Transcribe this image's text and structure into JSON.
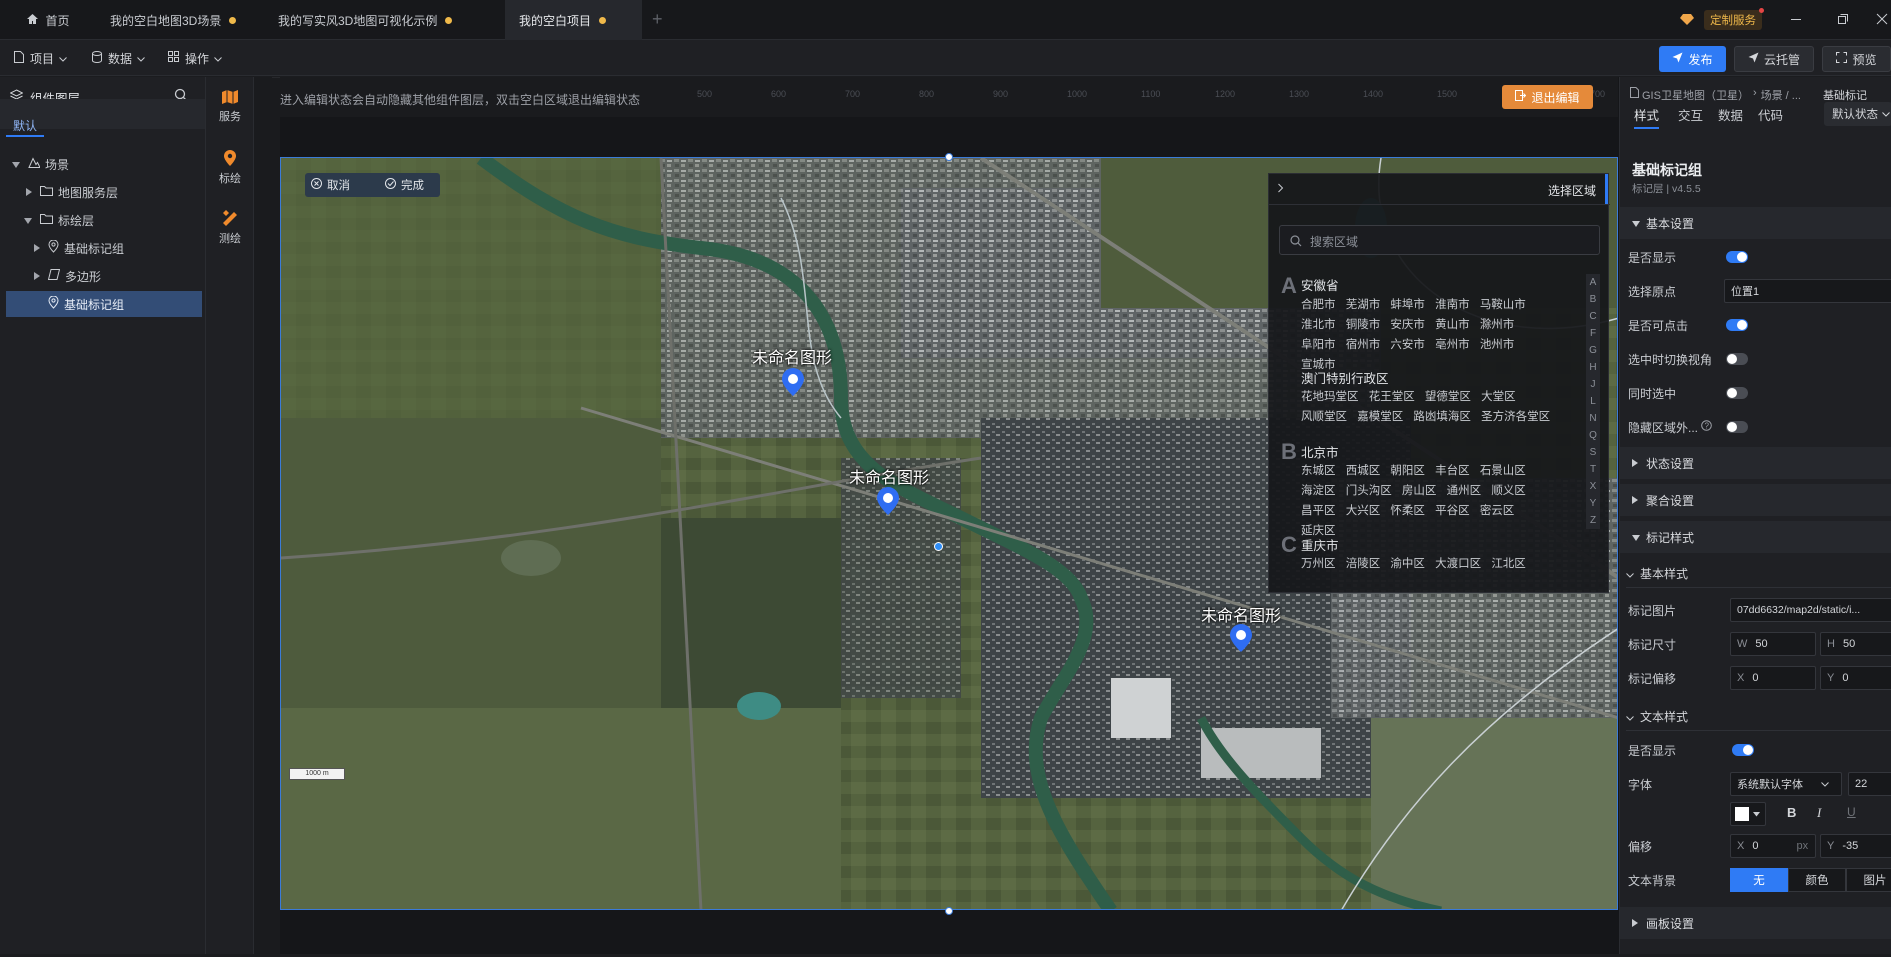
{
  "tabs": {
    "home": "首页",
    "items": [
      {
        "label": "我的空白地图3D场景"
      },
      {
        "label": "我的写实风3D地图可视化示例"
      },
      {
        "label": "我的空白项目"
      }
    ],
    "add": "+",
    "custom_service": "定制服务"
  },
  "menubar": {
    "project": "项目",
    "data": "数据",
    "operate": "操作",
    "publish": "发布",
    "cloud": "云托管",
    "preview": "预览"
  },
  "leftpanel": {
    "title": "组件图层",
    "tab_default": "默认",
    "tree": [
      {
        "label": "场景"
      },
      {
        "label": "地图服务层"
      },
      {
        "label": "标绘层"
      },
      {
        "label": "基础标记组"
      },
      {
        "label": "多边形"
      },
      {
        "label": "基础标记组"
      }
    ]
  },
  "iconstrip": {
    "service": "服务",
    "plot": "标绘",
    "measure": "测绘"
  },
  "canvas": {
    "hint": "进入编辑状态会自动隐藏其他组件图层，双击空白区域退出编辑状态",
    "exit_edit": "退出编辑",
    "ruler_top": [
      "500",
      "600",
      "700",
      "800",
      "900",
      "1000",
      "1100",
      "1200",
      "1300",
      "1400",
      "1500",
      "1600",
      "1700",
      "1800"
    ],
    "cancel": "取消",
    "done": "完成",
    "scale": "1000 m",
    "markers": [
      {
        "label": "未命名图形"
      },
      {
        "label": "未命名图形"
      },
      {
        "label": "未命名图形"
      }
    ]
  },
  "region": {
    "title": "选择区域",
    "search_placeholder": "搜索区域",
    "groups": [
      {
        "letter": "A",
        "provinces": [
          {
            "name": "安徽省",
            "cities": [
              "合肥市",
              "芜湖市",
              "蚌埠市",
              "淮南市",
              "马鞍山市",
              "淮北市",
              "铜陵市",
              "安庆市",
              "黄山市",
              "滁州市",
              "阜阳市",
              "宿州市",
              "六安市",
              "亳州市",
              "池州市",
              "宣城市"
            ]
          },
          {
            "name": "澳门特别行政区",
            "cities": [
              "花地玛堂区",
              "花王堂区",
              "望德堂区",
              "大堂区",
              "风顺堂区",
              "嘉模堂区",
              "路凼填海区",
              "圣方济各堂区"
            ]
          }
        ]
      },
      {
        "letter": "B",
        "provinces": [
          {
            "name": "北京市",
            "cities": [
              "东城区",
              "西城区",
              "朝阳区",
              "丰台区",
              "石景山区",
              "海淀区",
              "门头沟区",
              "房山区",
              "通州区",
              "顺义区",
              "昌平区",
              "大兴区",
              "怀柔区",
              "平谷区",
              "密云区",
              "延庆区"
            ]
          }
        ]
      },
      {
        "letter": "C",
        "provinces": [
          {
            "name": "重庆市",
            "cities": [
              "万州区",
              "涪陵区",
              "渝中区",
              "大渡口区",
              "江北区"
            ]
          }
        ]
      }
    ],
    "alphabet": [
      "A",
      "B",
      "C",
      "F",
      "G",
      "H",
      "J",
      "L",
      "N",
      "Q",
      "S",
      "T",
      "X",
      "Y",
      "Z"
    ]
  },
  "rightpanel": {
    "breadcrumb": [
      "GIS卫星地图（卫星）",
      "场景 / ...",
      "基础标记"
    ],
    "tabs": [
      "样式",
      "交互",
      "数据",
      "代码"
    ],
    "state": "默认状态",
    "component_title": "基础标记组",
    "component_sub": "标记层 | v4.5.5",
    "basic_settings": "基本设置",
    "show": "是否显示",
    "origin": "选择原点",
    "origin_value": "位置1",
    "clickable": "是否可点击",
    "switch_view": "选中时切换视角",
    "same_select": "同时选中",
    "hide_outside": "隐藏区域外...",
    "state_settings": "状态设置",
    "cluster_settings": "聚合设置",
    "marker_style": "标记样式",
    "basic_style": "基本样式",
    "marker_image": "标记图片",
    "marker_image_value": "07dd6632/map2d/static/i...",
    "marker_size": "标记尺寸",
    "size_w_prefix": "W",
    "size_w": "50",
    "size_h_prefix": "H",
    "size_h": "50",
    "marker_offset": "标记偏移",
    "offset_x_prefix": "X",
    "offset_x": "0",
    "offset_y_prefix": "Y",
    "offset_y": "0",
    "text_style": "文本样式",
    "text_show": "是否显示",
    "font": "字体",
    "font_value": "系统默认字体",
    "font_size": "22",
    "bold": "B",
    "italic": "I",
    "underline": "U",
    "text_offset": "偏移",
    "text_offset_x": "0",
    "text_offset_y": "-35",
    "px": "px",
    "text_bg": "文本背景",
    "bg_options": [
      "无",
      "颜色",
      "图片"
    ],
    "panel_settings": "画板设置"
  }
}
